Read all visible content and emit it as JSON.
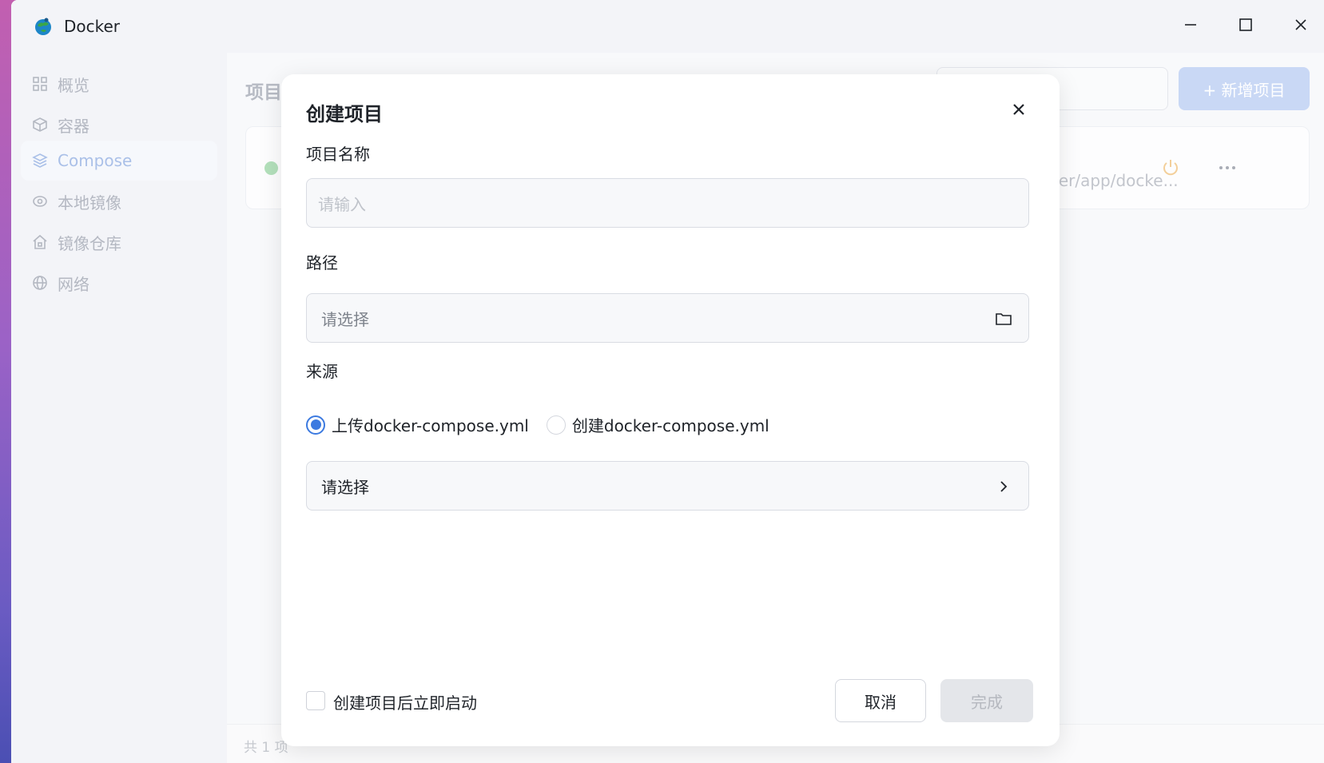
{
  "window": {
    "title": "Docker",
    "controls": {
      "minimize": "minimize-icon",
      "maximize": "maximize-icon",
      "close": "close-icon"
    }
  },
  "sidebar": {
    "items": [
      {
        "label": "概览",
        "icon": "grid-icon",
        "active": false
      },
      {
        "label": "容器",
        "icon": "cube-icon",
        "active": false
      },
      {
        "label": "Compose",
        "icon": "layers-icon",
        "active": true
      },
      {
        "label": "本地镜像",
        "icon": "disc-icon",
        "active": false
      },
      {
        "label": "镜像仓库",
        "icon": "home-icon",
        "active": false
      },
      {
        "label": "网络",
        "icon": "globe-icon",
        "active": false
      }
    ]
  },
  "main": {
    "title": "项目",
    "add_button_label": "+ 新增项目",
    "project": {
      "status": "running",
      "path": "ver/app/docke..."
    },
    "footer_count": "共 1 项"
  },
  "dialog": {
    "title": "创建项目",
    "name_label": "项目名称",
    "name_placeholder": "请输入",
    "path_label": "路径",
    "path_placeholder": "请选择",
    "source_label": "来源",
    "source_options": [
      {
        "label": "上传docker-compose.yml",
        "checked": true
      },
      {
        "label": "创建docker-compose.yml",
        "checked": false
      }
    ],
    "file_select_label": "请选择",
    "autostart_label": "创建项目后立即启动",
    "autostart_checked": false,
    "cancel_label": "取消",
    "done_label": "完成"
  },
  "colors": {
    "accent": "#3c7ae0",
    "add_button_disabled": "#c9d8f5",
    "status_running": "#b3e0bb",
    "power_icon": "#f3cf9a"
  }
}
